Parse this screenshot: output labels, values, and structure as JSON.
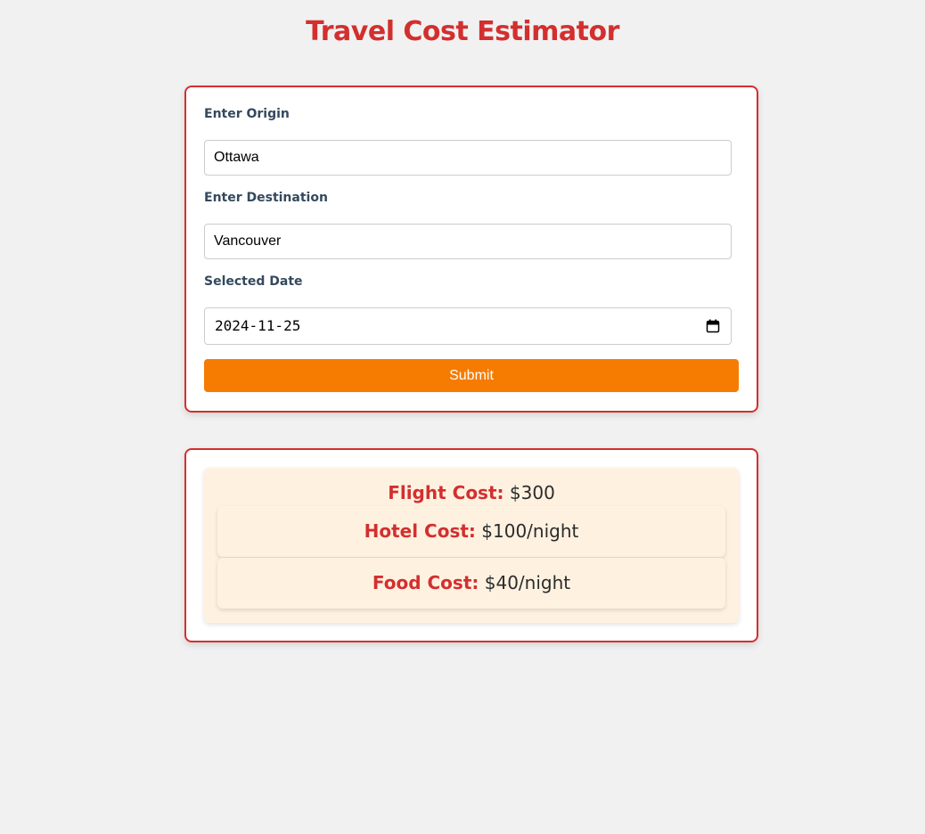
{
  "title": "Travel Cost Estimator",
  "form": {
    "origin_label": "Enter Origin",
    "origin_value": "Ottawa",
    "destination_label": "Enter Destination",
    "destination_value": "Vancouver",
    "date_label": "Selected Date",
    "date_value": "2024-11-25",
    "submit_label": "Submit"
  },
  "results": {
    "flight": {
      "label": "Flight Cost:",
      "value": "$300"
    },
    "hotel": {
      "label": "Hotel Cost:",
      "value": "$100/night"
    },
    "food": {
      "label": "Food Cost:",
      "value": "$40/night"
    }
  },
  "colors": {
    "accent_red": "#d32f2f",
    "submit_orange": "#f57c00",
    "label_slate": "#34495e",
    "result_background": "#fff1e0",
    "page_background": "#f1f1f1"
  },
  "icons": {
    "date_picker": "calendar-icon"
  }
}
